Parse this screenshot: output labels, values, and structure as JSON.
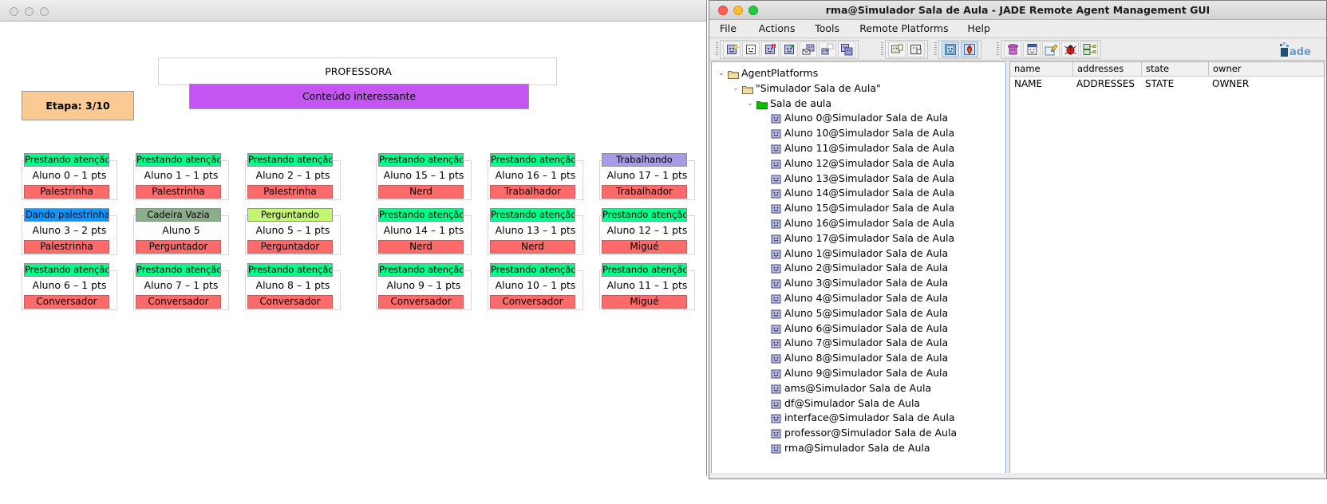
{
  "simulator": {
    "window_dots": [
      "dot-1",
      "dot-2",
      "dot-3"
    ],
    "professora": {
      "title": "PROFESSORA",
      "content": "Conteúdo interessante",
      "content_color": "#c455f0"
    },
    "etapa": {
      "label": "Etapa: 3/10",
      "color": "#fbc992"
    },
    "students": [
      {
        "status": "Prestando atenção",
        "status_kind": "atento",
        "who": "Aluno 0 – 1 pts",
        "persona": "Palestrinha"
      },
      {
        "status": "Prestando atenção",
        "status_kind": "atento",
        "who": "Aluno 1 – 1 pts",
        "persona": "Palestrinha"
      },
      {
        "status": "Prestando atenção",
        "status_kind": "atento",
        "who": "Aluno 2 – 1 pts",
        "persona": "Palestrinha"
      },
      {
        "status": "Prestando atenção",
        "status_kind": "atento",
        "who": "Aluno 15 – 1 pts",
        "persona": "Nerd"
      },
      {
        "status": "Prestando atenção",
        "status_kind": "atento",
        "who": "Aluno 16 – 1 pts",
        "persona": "Trabalhador"
      },
      {
        "status": "Trabalhando",
        "status_kind": "trabalha",
        "who": "Aluno 17 – 1 pts",
        "persona": "Trabalhador"
      },
      {
        "status": "Dando palestrinha",
        "status_kind": "palestra",
        "who": "Aluno 3 – 2 pts",
        "persona": "Palestrinha"
      },
      {
        "status": "Cadeira Vazia",
        "status_kind": "vazia",
        "who": "Aluno 5",
        "persona": "Perguntador"
      },
      {
        "status": "Perguntando",
        "status_kind": "pergunta",
        "who": "Aluno 5 – 1 pts",
        "persona": "Perguntador"
      },
      {
        "status": "Prestando atenção",
        "status_kind": "atento",
        "who": "Aluno 14 – 1 pts",
        "persona": "Nerd"
      },
      {
        "status": "Prestando atenção",
        "status_kind": "atento",
        "who": "Aluno 13 – 1 pts",
        "persona": "Nerd"
      },
      {
        "status": "Prestando atenção",
        "status_kind": "atento",
        "who": "Aluno 12 – 1 pts",
        "persona": "Migué"
      },
      {
        "status": "Prestando atenção",
        "status_kind": "atento",
        "who": "Aluno 6 – 1 pts",
        "persona": "Conversador"
      },
      {
        "status": "Prestando atenção",
        "status_kind": "atento",
        "who": "Aluno 7 – 1 pts",
        "persona": "Conversador"
      },
      {
        "status": "Prestando atenção",
        "status_kind": "atento",
        "who": "Aluno 8 – 1 pts",
        "persona": "Conversador"
      },
      {
        "status": "Prestando atenção",
        "status_kind": "atento",
        "who": "Aluno 9 – 1 pts",
        "persona": "Conversador"
      },
      {
        "status": "Prestando atenção",
        "status_kind": "atento",
        "who": "Aluno 10 – 1 pts",
        "persona": "Conversador"
      },
      {
        "status": "Prestando atenção",
        "status_kind": "atento",
        "who": "Aluno 11 – 1 pts",
        "persona": "Migué"
      }
    ],
    "status_colors": {
      "atento": "#00fe8b",
      "palestra": "#1296fb",
      "vazia": "#8bad8b",
      "pergunta": "#c4f571",
      "trabalha": "#a99ae6",
      "persona": "#fc6a6a"
    }
  },
  "jade": {
    "title": "rma@Simulador Sala de Aula - JADE Remote Agent Management GUI",
    "menus": [
      {
        "label": "File"
      },
      {
        "label": "Actions"
      },
      {
        "label": "Tools"
      },
      {
        "label": "Remote Platforms"
      },
      {
        "label": "Help"
      }
    ],
    "toolbar": {
      "group1": [
        "start-new-agent-icon",
        "kill-agent-icon",
        "suspend-agent-icon",
        "resume-agent-icon",
        "send-message-icon",
        "migrate-agent-icon",
        "clone-agent-icon"
      ],
      "group2": [
        "load-platform-icon",
        "save-platform-icon"
      ],
      "group3": [
        "add-platform-icon",
        "remove-platform-icon"
      ],
      "group4": [
        "sniffer-agent-icon",
        "dummy-agent-icon",
        "log-manager-icon",
        "introspector-agent-icon",
        "df-agent-icon"
      ],
      "logo": "jade-logo"
    },
    "tree": [
      {
        "depth": 0,
        "label": "AgentPlatforms",
        "icon": "folder-yellow-icon",
        "twisty": "⌄"
      },
      {
        "depth": 1,
        "label": "\"Simulador Sala de Aula\"",
        "icon": "folder-yellow-icon",
        "twisty": "⌄"
      },
      {
        "depth": 2,
        "label": "Sala de aula",
        "icon": "folder-green-icon",
        "twisty": "⌄"
      },
      {
        "depth": 3,
        "label": "Aluno 0@Simulador Sala de Aula",
        "icon": "agent-icon",
        "twisty": ""
      },
      {
        "depth": 3,
        "label": "Aluno 10@Simulador Sala de Aula",
        "icon": "agent-icon",
        "twisty": ""
      },
      {
        "depth": 3,
        "label": "Aluno 11@Simulador Sala de Aula",
        "icon": "agent-icon",
        "twisty": ""
      },
      {
        "depth": 3,
        "label": "Aluno 12@Simulador Sala de Aula",
        "icon": "agent-icon",
        "twisty": ""
      },
      {
        "depth": 3,
        "label": "Aluno 13@Simulador Sala de Aula",
        "icon": "agent-icon",
        "twisty": ""
      },
      {
        "depth": 3,
        "label": "Aluno 14@Simulador Sala de Aula",
        "icon": "agent-icon",
        "twisty": ""
      },
      {
        "depth": 3,
        "label": "Aluno 15@Simulador Sala de Aula",
        "icon": "agent-icon",
        "twisty": ""
      },
      {
        "depth": 3,
        "label": "Aluno 16@Simulador Sala de Aula",
        "icon": "agent-icon",
        "twisty": ""
      },
      {
        "depth": 3,
        "label": "Aluno 17@Simulador Sala de Aula",
        "icon": "agent-icon",
        "twisty": ""
      },
      {
        "depth": 3,
        "label": "Aluno 1@Simulador Sala de Aula",
        "icon": "agent-icon",
        "twisty": ""
      },
      {
        "depth": 3,
        "label": "Aluno 2@Simulador Sala de Aula",
        "icon": "agent-icon",
        "twisty": ""
      },
      {
        "depth": 3,
        "label": "Aluno 3@Simulador Sala de Aula",
        "icon": "agent-icon",
        "twisty": ""
      },
      {
        "depth": 3,
        "label": "Aluno 4@Simulador Sala de Aula",
        "icon": "agent-icon",
        "twisty": ""
      },
      {
        "depth": 3,
        "label": "Aluno 5@Simulador Sala de Aula",
        "icon": "agent-icon",
        "twisty": ""
      },
      {
        "depth": 3,
        "label": "Aluno 6@Simulador Sala de Aula",
        "icon": "agent-icon",
        "twisty": ""
      },
      {
        "depth": 3,
        "label": "Aluno 7@Simulador Sala de Aula",
        "icon": "agent-icon",
        "twisty": ""
      },
      {
        "depth": 3,
        "label": "Aluno 8@Simulador Sala de Aula",
        "icon": "agent-icon",
        "twisty": ""
      },
      {
        "depth": 3,
        "label": "Aluno 9@Simulador Sala de Aula",
        "icon": "agent-icon",
        "twisty": ""
      },
      {
        "depth": 3,
        "label": "ams@Simulador Sala de Aula",
        "icon": "agent-icon",
        "twisty": ""
      },
      {
        "depth": 3,
        "label": "df@Simulador Sala de Aula",
        "icon": "agent-icon",
        "twisty": ""
      },
      {
        "depth": 3,
        "label": "interface@Simulador Sala de Aula",
        "icon": "agent-icon",
        "twisty": ""
      },
      {
        "depth": 3,
        "label": "professor@Simulador Sala de Aula",
        "icon": "agent-icon",
        "twisty": ""
      },
      {
        "depth": 3,
        "label": "rma@Simulador Sala de Aula",
        "icon": "agent-icon",
        "twisty": ""
      }
    ],
    "table": {
      "headers": [
        "name",
        "addresses",
        "state",
        "owner"
      ],
      "rows": [
        [
          "NAME",
          "ADDRESSES",
          "STATE",
          "OWNER"
        ]
      ]
    }
  }
}
